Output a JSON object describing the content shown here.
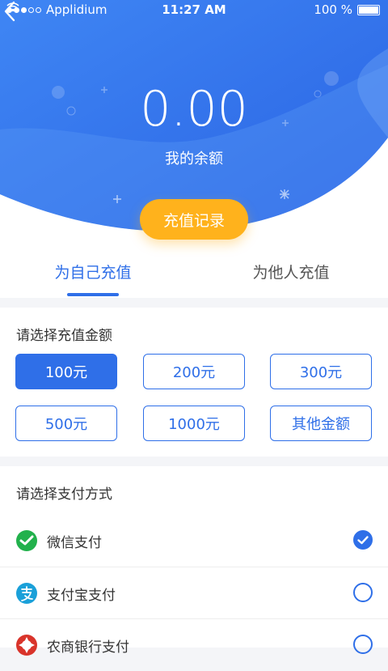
{
  "status_bar": {
    "carrier": "Applidium",
    "time": "11:27 AM",
    "battery": "100 %"
  },
  "header": {
    "balance_value": "0.00",
    "balance_label": "我的余额",
    "record_button": "充值记录"
  },
  "tabs": [
    {
      "label": "为自己充值",
      "active": true
    },
    {
      "label": "为他人充值",
      "active": false
    }
  ],
  "amount_section": {
    "title": "请选择充值金额",
    "options": [
      {
        "label": "100元",
        "selected": true
      },
      {
        "label": "200元",
        "selected": false
      },
      {
        "label": "300元",
        "selected": false
      },
      {
        "label": "500元",
        "selected": false
      },
      {
        "label": "1000元",
        "selected": false
      },
      {
        "label": "其他金额",
        "selected": false
      }
    ]
  },
  "payment_section": {
    "title": "请选择支付方式",
    "methods": [
      {
        "label": "微信支付",
        "icon": "wechat-pay-icon",
        "checked": true
      },
      {
        "label": "支付宝支付",
        "icon": "alipay-icon",
        "checked": false
      },
      {
        "label": "农商银行支付",
        "icon": "rural-bank-icon",
        "checked": false
      }
    ]
  },
  "colors": {
    "accent": "#2f6fe8",
    "button": "#ffb21c",
    "hero_top": "#3b7cf2",
    "hero_bottom": "#2f6be6"
  }
}
